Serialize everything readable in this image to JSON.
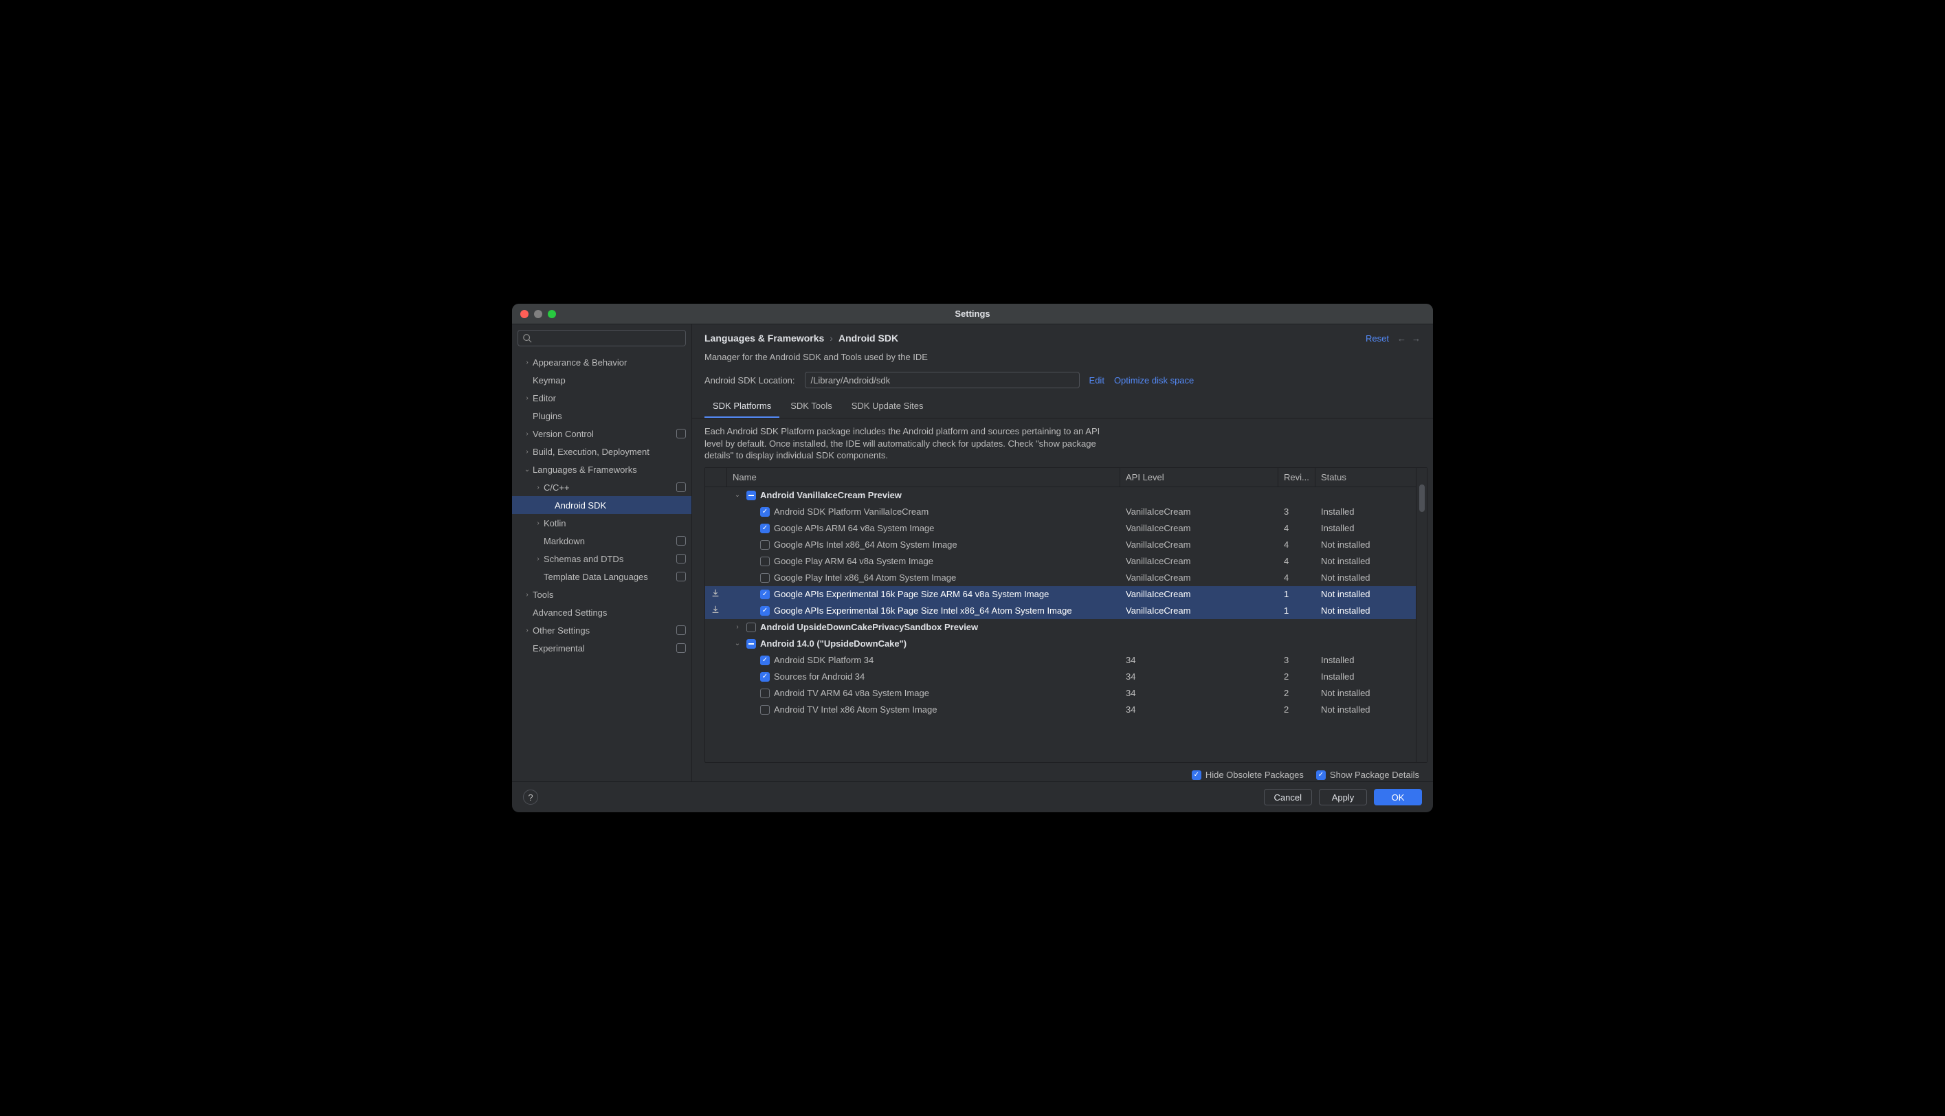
{
  "window_title": "Settings",
  "search_placeholder": "",
  "sidebar": [
    {
      "label": "Appearance & Behavior",
      "depth": 0,
      "chev": "right"
    },
    {
      "label": "Keymap",
      "depth": 0
    },
    {
      "label": "Editor",
      "depth": 0,
      "chev": "right"
    },
    {
      "label": "Plugins",
      "depth": 0
    },
    {
      "label": "Version Control",
      "depth": 0,
      "chev": "right",
      "tag": true
    },
    {
      "label": "Build, Execution, Deployment",
      "depth": 0,
      "chev": "right"
    },
    {
      "label": "Languages & Frameworks",
      "depth": 0,
      "chev": "down"
    },
    {
      "label": "C/C++",
      "depth": 1,
      "chev": "right",
      "tag": true
    },
    {
      "label": "Android SDK",
      "depth": 2,
      "selected": true
    },
    {
      "label": "Kotlin",
      "depth": 1,
      "chev": "right"
    },
    {
      "label": "Markdown",
      "depth": 1,
      "tag": true
    },
    {
      "label": "Schemas and DTDs",
      "depth": 1,
      "chev": "right",
      "tag": true
    },
    {
      "label": "Template Data Languages",
      "depth": 1,
      "tag": true
    },
    {
      "label": "Tools",
      "depth": 0,
      "chev": "right"
    },
    {
      "label": "Advanced Settings",
      "depth": 0
    },
    {
      "label": "Other Settings",
      "depth": 0,
      "chev": "right",
      "tag": true
    },
    {
      "label": "Experimental",
      "depth": 0,
      "tag": true
    }
  ],
  "breadcrumb": {
    "parent": "Languages & Frameworks",
    "sep": "›",
    "current": "Android SDK"
  },
  "reset_label": "Reset",
  "manager_desc": "Manager for the Android SDK and Tools used by the IDE",
  "sdk_location_label": "Android SDK Location:",
  "sdk_location_value": "/Library/Android/sdk",
  "edit_label": "Edit",
  "optimize_label": "Optimize disk space",
  "tabs": [
    "SDK Platforms",
    "SDK Tools",
    "SDK Update Sites"
  ],
  "active_tab": 0,
  "info_text": "Each Android SDK Platform package includes the Android platform and sources pertaining to an API level by default. Once installed, the IDE will automatically check for updates. Check \"show package details\" to display individual SDK components.",
  "columns": {
    "name": "Name",
    "api": "API Level",
    "rev": "Revi...",
    "status": "Status"
  },
  "rows": [
    {
      "type": "platform",
      "expand": "down",
      "cb": "partial",
      "name": "Android VanillaIceCream Preview",
      "indent": 0
    },
    {
      "type": "pkg",
      "cb": "checked",
      "name": "Android SDK Platform VanillaIceCream",
      "api": "VanillaIceCream",
      "rev": "3",
      "status": "Installed",
      "indent": 1
    },
    {
      "type": "pkg",
      "cb": "checked",
      "name": "Google APIs ARM 64 v8a System Image",
      "api": "VanillaIceCream",
      "rev": "4",
      "status": "Installed",
      "indent": 1
    },
    {
      "type": "pkg",
      "cb": "",
      "name": "Google APIs Intel x86_64 Atom System Image",
      "api": "VanillaIceCream",
      "rev": "4",
      "status": "Not installed",
      "indent": 1
    },
    {
      "type": "pkg",
      "cb": "",
      "name": "Google Play ARM 64 v8a System Image",
      "api": "VanillaIceCream",
      "rev": "4",
      "status": "Not installed",
      "indent": 1
    },
    {
      "type": "pkg",
      "cb": "",
      "name": "Google Play Intel x86_64 Atom System Image",
      "api": "VanillaIceCream",
      "rev": "4",
      "status": "Not installed",
      "indent": 1
    },
    {
      "type": "pkg",
      "cb": "checked",
      "name": "Google APIs Experimental 16k Page Size ARM 64 v8a System Image",
      "api": "VanillaIceCream",
      "rev": "1",
      "status": "Not installed",
      "indent": 1,
      "sel": true,
      "dl": true
    },
    {
      "type": "pkg",
      "cb": "checked",
      "name": "Google APIs Experimental 16k Page Size Intel x86_64 Atom System Image",
      "api": "VanillaIceCream",
      "rev": "1",
      "status": "Not installed",
      "indent": 1,
      "sel": true,
      "dl": true
    },
    {
      "type": "platform",
      "expand": "right",
      "cb": "",
      "name": "Android UpsideDownCakePrivacySandbox Preview",
      "indent": 0
    },
    {
      "type": "platform",
      "expand": "down",
      "cb": "partial",
      "name": "Android 14.0 (\"UpsideDownCake\")",
      "indent": 0
    },
    {
      "type": "pkg",
      "cb": "checked",
      "name": "Android SDK Platform 34",
      "api": "34",
      "rev": "3",
      "status": "Installed",
      "indent": 1
    },
    {
      "type": "pkg",
      "cb": "checked",
      "name": "Sources for Android 34",
      "api": "34",
      "rev": "2",
      "status": "Installed",
      "indent": 1
    },
    {
      "type": "pkg",
      "cb": "",
      "name": "Android TV ARM 64 v8a System Image",
      "api": "34",
      "rev": "2",
      "status": "Not installed",
      "indent": 1
    },
    {
      "type": "pkg",
      "cb": "",
      "name": "Android TV Intel x86 Atom System Image",
      "api": "34",
      "rev": "2",
      "status": "Not installed",
      "indent": 1
    }
  ],
  "hide_obsolete_label": "Hide Obsolete Packages",
  "show_details_label": "Show Package Details",
  "footer": {
    "cancel": "Cancel",
    "apply": "Apply",
    "ok": "OK"
  }
}
